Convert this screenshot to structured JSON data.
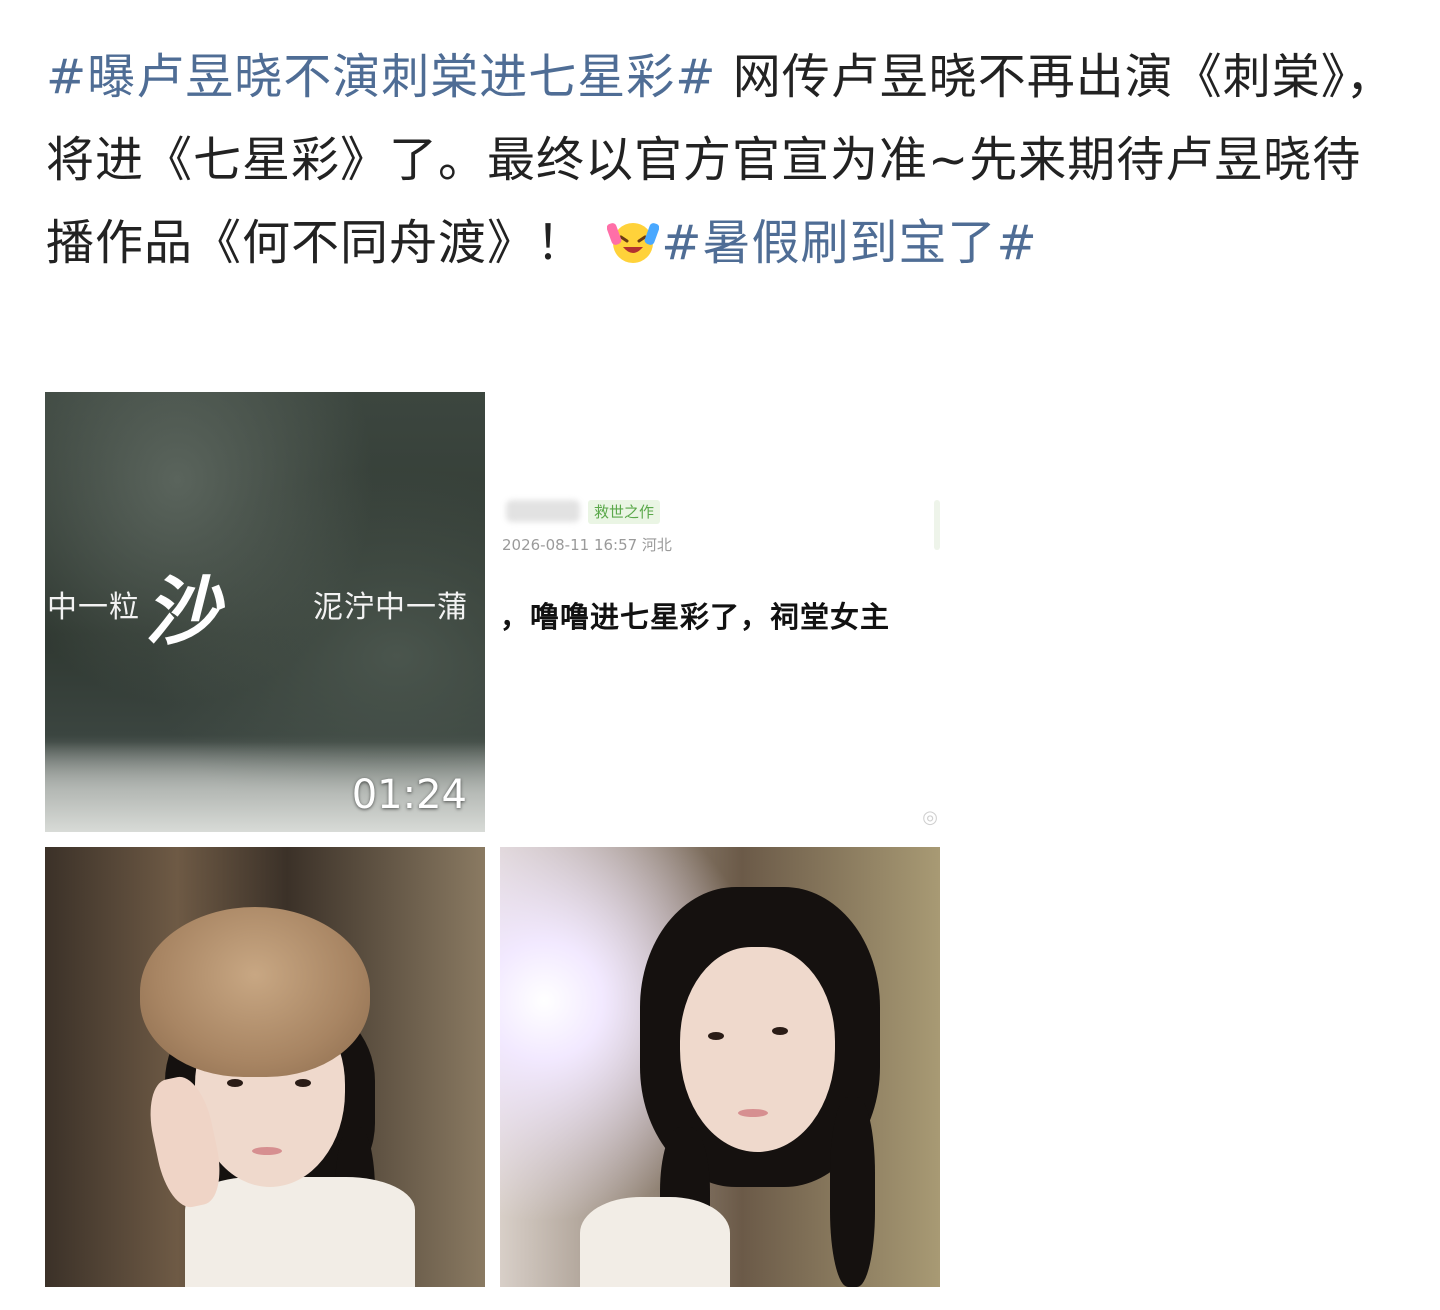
{
  "post": {
    "hashtag_1": "#曝卢昱晓不演刺棠进七星彩#",
    "text_1": " 网传卢昱晓不再出演《刺棠》，将进《七星彩》了。最终以官方官宣为准~先来期待卢昱晓待播作品《何不同舟渡》！",
    "emoji": "laughing-crying-emoji",
    "hashtag_2": "#暑假刷到宝了#"
  },
  "media": {
    "video": {
      "caption_left": "中一粒",
      "caption_big": "沙",
      "caption_right": "泥泞中一蒲",
      "duration": "01:24"
    },
    "screenshot": {
      "badge": "救世之作",
      "meta": "2026-08-11 16:57  河北",
      "main_text": "，噜噜进七星彩了，祠堂女主"
    }
  },
  "colors": {
    "hashtag": "#4f6d95",
    "body_text": "#222222",
    "badge_green": "#5aa84a"
  }
}
